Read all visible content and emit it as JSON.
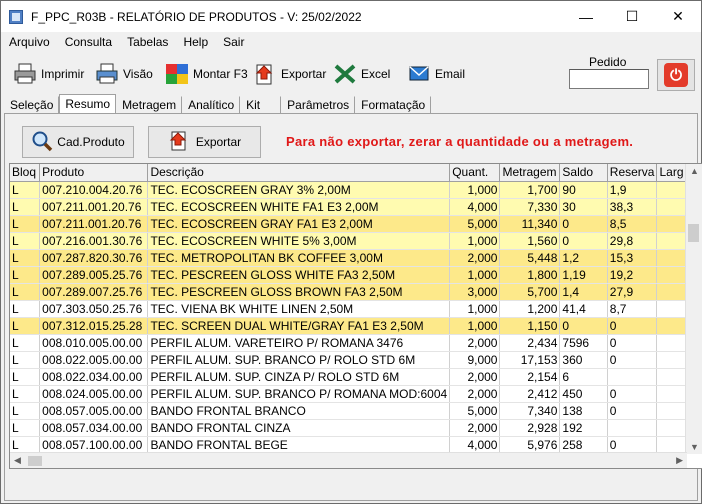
{
  "window": {
    "title": "F_PPC_R03B - RELATÓRIO DE PRODUTOS - V: 25/02/2022",
    "controls": {
      "minimize": "—",
      "maximize": "☐",
      "close": "✕"
    }
  },
  "menu": [
    {
      "label": "Arquivo",
      "underline": "A"
    },
    {
      "label": "Consulta",
      "underline": "C"
    },
    {
      "label": "Tabelas",
      "underline": "T"
    },
    {
      "label": "Help",
      "underline": "H"
    },
    {
      "label": "Sair",
      "underline": "S"
    }
  ],
  "toolbar": {
    "imprimir": "Imprimir",
    "visao": "Visão",
    "montar": "Montar F3",
    "exportar": "Exportar",
    "excel": "Excel",
    "email": "Email",
    "pedido_label": "Pedido",
    "pedido_value": ""
  },
  "tabs": [
    "Seleção",
    "Resumo",
    "Metragem",
    "Analítico",
    "Kit",
    "Parâmetros",
    "Formatação"
  ],
  "active_tab": "Resumo",
  "panel": {
    "cad_produto": "Cad.Produto",
    "exportar": "Exportar",
    "warning": "Para não exportar, zerar a quantidade ou a metragem."
  },
  "grid": {
    "columns": [
      "Bloq",
      "Produto",
      "Descrição",
      "Quant.",
      "Metragem",
      "Saldo",
      "Reserva",
      "Larg"
    ],
    "rows": [
      {
        "style": "hl",
        "cells": [
          "L",
          "007.210.004.20.76",
          "TEC. ECOSCREEN GRAY 3% 2,00M",
          "1,000",
          "1,700",
          "90",
          "1,9",
          ""
        ]
      },
      {
        "style": "hl",
        "cells": [
          "L",
          "007.211.001.20.76",
          "TEC. ECOSCREEN WHITE FA1 E3 2,00M",
          "4,000",
          "7,330",
          "30",
          "38,3",
          ""
        ]
      },
      {
        "style": "hl2",
        "cells": [
          "L",
          "007.211.001.20.76",
          "TEC. ECOSCREEN GRAY FA1 E3 2,00M",
          "5,000",
          "11,340",
          "0",
          "8,5",
          ""
        ]
      },
      {
        "style": "hl",
        "cells": [
          "L",
          "007.216.001.30.76",
          "TEC. ECOSCREEN WHITE 5% 3,00M",
          "1,000",
          "1,560",
          "0",
          "29,8",
          ""
        ]
      },
      {
        "style": "hl2",
        "cells": [
          "L",
          "007.287.820.30.76",
          "TEC. METROPOLITAN BK COFFEE 3,00M",
          "2,000",
          "5,448",
          "1,2",
          "15,3",
          ""
        ]
      },
      {
        "style": "hl2",
        "cells": [
          "L",
          "007.289.005.25.76",
          "TEC. PESCREEN GLOSS WHITE FA3 2,50M",
          "1,000",
          "1,800",
          "1,19",
          "19,2",
          ""
        ]
      },
      {
        "style": "hl2",
        "cells": [
          "L",
          "007.289.007.25.76",
          "TEC. PESCREEN GLOSS BROWN FA3 2,50M",
          "3,000",
          "5,700",
          "1,4",
          "27,9",
          ""
        ]
      },
      {
        "style": "plain",
        "cells": [
          "L",
          "007.303.050.25.76",
          "TEC. VIENA BK WHITE LINEN 2,50M",
          "1,000",
          "1,200",
          "41,4",
          "8,7",
          ""
        ]
      },
      {
        "style": "hl2",
        "cells": [
          "L",
          "007.312.015.25.28",
          "TEC. SCREEN DUAL WHITE/GRAY FA1 E3 2,50M",
          "1,000",
          "1,150",
          "0",
          "0",
          ""
        ]
      },
      {
        "style": "plain",
        "cells": [
          "L",
          "008.010.005.00.00",
          "PERFIL ALUM. VARETEIRO P/ ROMANA 3476",
          "2,000",
          "2,434",
          "7596",
          "0",
          ""
        ]
      },
      {
        "style": "plain",
        "cells": [
          "L",
          "008.022.005.00.00",
          "PERFIL ALUM. SUP. BRANCO P/ ROLO STD 6M",
          "9,000",
          "17,153",
          "360",
          "0",
          ""
        ]
      },
      {
        "style": "plain",
        "cells": [
          "L",
          "008.022.034.00.00",
          "PERFIL ALUM. SUP. CINZA P/ ROLO STD 6M",
          "2,000",
          "2,154",
          "6",
          "",
          ""
        ]
      },
      {
        "style": "plain",
        "cells": [
          "L",
          "008.024.005.00.00",
          "PERFIL ALUM. SUP. BRANCO P/ ROMANA MOD:6004",
          "2,000",
          "2,412",
          "450",
          "0",
          ""
        ]
      },
      {
        "style": "plain",
        "cells": [
          "L",
          "008.057.005.00.00",
          "BANDO FRONTAL BRANCO",
          "5,000",
          "7,340",
          "138",
          "0",
          ""
        ]
      },
      {
        "style": "plain",
        "cells": [
          "L",
          "008.057.034.00.00",
          "BANDO FRONTAL CINZA",
          "2,000",
          "2,928",
          "192",
          "",
          ""
        ]
      },
      {
        "style": "plain",
        "cells": [
          "L",
          "008.057.100.00.00",
          "BANDO FRONTAL BEGE",
          "4,000",
          "5,976",
          "258",
          "0",
          ""
        ]
      }
    ]
  },
  "colors": {
    "row_highlight_light": "#fffbb0",
    "row_highlight_dark": "#fde98a",
    "warning_text": "#e01818",
    "power_button": "#e33b2a"
  },
  "icons": {
    "imprimir": "printer-icon",
    "visao": "preview-printer-icon",
    "montar": "puzzle-icon",
    "exportar": "export-document-icon",
    "excel": "excel-icon",
    "email": "email-icon",
    "power": "power-icon",
    "cad_produto": "magnifier-icon"
  }
}
